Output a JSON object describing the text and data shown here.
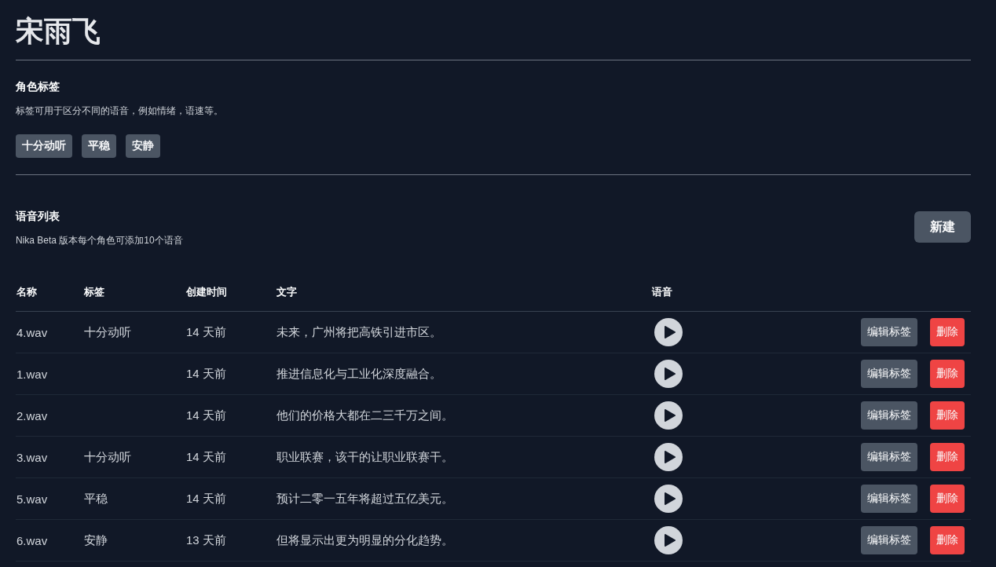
{
  "title": "宋雨飞",
  "tags_section": {
    "heading": "角色标签",
    "description": "标签可用于区分不同的语音，例如情绪，语速等。",
    "tags": [
      "十分动听",
      "平稳",
      "安静"
    ]
  },
  "voices_section": {
    "heading": "语音列表",
    "description": "Nika Beta 版本每个角色可添加10个语音",
    "new_button": "新建"
  },
  "table": {
    "columns": [
      "名称",
      "标签",
      "创建时间",
      "文字",
      "语音"
    ],
    "rows": [
      {
        "name": "4.wav",
        "tag": "十分动听",
        "created": "14 天前",
        "text": "未来，广州将把高铁引进市区。",
        "edit_button": "编辑标签",
        "delete_button": "删除"
      },
      {
        "name": "1.wav",
        "created": "14 天前",
        "text": "推进信息化与工业化深度融合。",
        "edit_button": "编辑标签",
        "delete_button": "删除"
      },
      {
        "name": "2.wav",
        "created": "14 天前",
        "text": "他们的价格大都在二三千万之间。",
        "edit_button": "编辑标签",
        "delete_button": "删除"
      },
      {
        "name": "3.wav",
        "tag": "十分动听",
        "created": "14 天前",
        "text": "职业联赛，该干的让职业联赛干。",
        "edit_button": "编辑标签",
        "delete_button": "删除"
      },
      {
        "name": "5.wav",
        "tag": "平稳",
        "created": "14 天前",
        "text": "预计二零一五年将超过五亿美元。",
        "edit_button": "编辑标签",
        "delete_button": "删除"
      },
      {
        "name": "6.wav",
        "tag": "安静",
        "created": "13 天前",
        "text": "但将显示出更为明显的分化趋势。",
        "edit_button": "编辑标签",
        "delete_button": "删除"
      }
    ]
  }
}
